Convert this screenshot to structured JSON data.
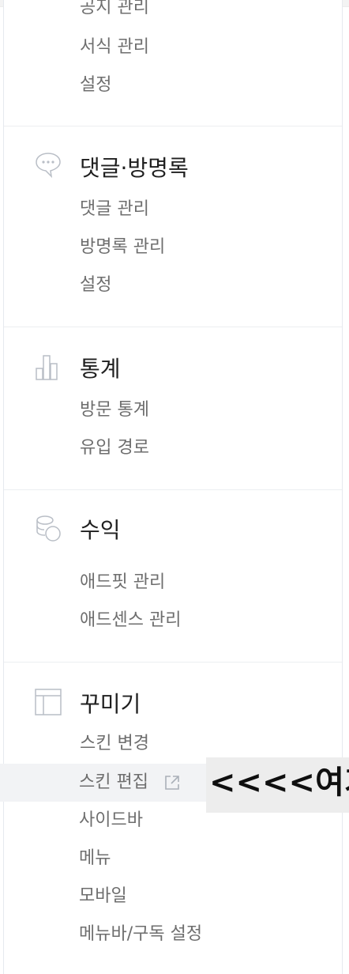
{
  "sections": [
    {
      "title": "",
      "items": [
        "공지 관리",
        "서식 관리",
        "설정"
      ]
    },
    {
      "title": "댓글·방명록",
      "icon": "comment-bubble-icon",
      "items": [
        "댓글 관리",
        "방명록 관리",
        "설정"
      ]
    },
    {
      "title": "통계",
      "icon": "bar-chart-icon",
      "items": [
        "방문 통계",
        "유입 경로"
      ]
    },
    {
      "title": "수익",
      "icon": "coins-icon",
      "items": [
        "애드핏 관리",
        "애드센스 관리"
      ]
    },
    {
      "title": "꾸미기",
      "icon": "layout-icon",
      "items": [
        "스킨 변경",
        "스킨 편집",
        "사이드바",
        "메뉴",
        "모바일",
        "메뉴바/구독 설정"
      ]
    }
  ],
  "callout": {
    "text": "<<<<여기"
  },
  "colors": {
    "title": "#1f1f1f",
    "item": "#6e6e6e",
    "icon": "#b9bec6",
    "highlight": "#f2f3f5"
  }
}
